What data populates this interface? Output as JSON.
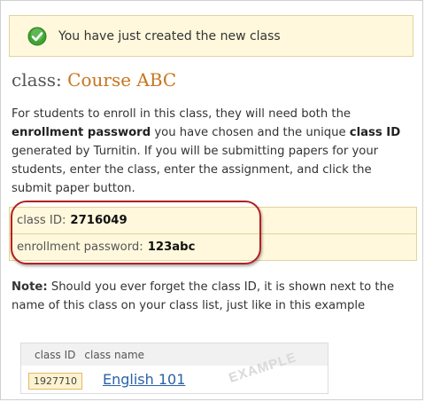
{
  "success": {
    "message": "You have just created the new class",
    "icon": "check-circle-icon",
    "icon_color": "#3ea530"
  },
  "title": {
    "prefix": "class: ",
    "name": "Course ABC"
  },
  "description": {
    "part1": "For students to enroll in this class, they will need both the ",
    "bold1": "enrollment password",
    "part2": " you have chosen and the unique ",
    "bold2": "class ID",
    "part3": " generated by Turnitin. If you will be submitting papers for your students, enter the class, enter the assignment, and click the submit paper button."
  },
  "info": {
    "class_id_label": "class ID:",
    "class_id_value": "2716049",
    "password_label": "enrollment password:",
    "password_value": "123abc"
  },
  "note": {
    "label": "Note:",
    "text": " Should you ever forget the class ID, it is shown next to the name of this class on your class list, just like in this example"
  },
  "example": {
    "col_id": "class ID",
    "col_name": "class name",
    "row_id": "1927710",
    "row_name": "English 101",
    "stamp": "EXAMPLE"
  },
  "colors": {
    "accent_orange": "#c8751e",
    "highlight_red": "#b32020",
    "link_blue": "#2a62a8",
    "panel_yellow": "#fff8dc"
  }
}
